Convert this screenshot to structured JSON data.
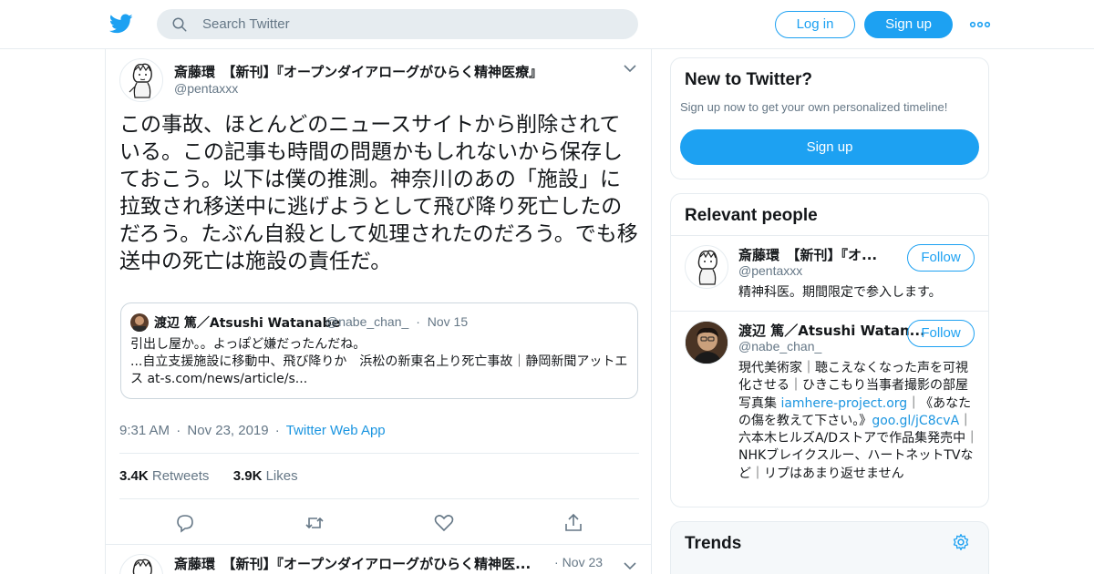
{
  "header": {
    "logo": "twitter-bird-icon",
    "search_placeholder": "Search Twitter",
    "login_label": "Log in",
    "signup_label": "Sign up",
    "more_icon": "more-dots-icon"
  },
  "tweet": {
    "author_name": "斎藤環　【新刊】『オープンダイアローグがひらく精神医療』",
    "author_handle": "@pentaxxx",
    "text": "この事故、ほとんどのニュースサイトから削除されている。この記事も時間の問題かもしれないから保存しておこう。以下は僕の推測。神奈川のあの「施設」に拉致され移送中に逃げようとして飛び降り死亡したのだろう。たぶん自殺として処理されたのだろう。でも移送中の死亡は施設の責任だ。",
    "quote": {
      "name": "渡辺 篤／Atsushi Watanabe",
      "handle": "@nabe_chan_",
      "date": "Nov 15",
      "line1": "引出し屋か。。よっぽど嫌だったんだね。",
      "line2": "...自立支援施設に移動中、飛び降りか　浜松の新東名上り死亡事故｜静岡新聞アットエス at-s.com/news/article/s..."
    },
    "time": "9:31 AM",
    "date": "Nov 23, 2019",
    "source": "Twitter Web App",
    "retweets_count": "3.4K",
    "retweets_label": "Retweets",
    "likes_count": "3.9K",
    "likes_label": "Likes",
    "actions": [
      "reply-icon",
      "retweet-icon",
      "like-icon",
      "share-icon"
    ]
  },
  "next_tweet": {
    "author_name": "斎藤環　【新刊】『オープンダイアローグがひらく精神医...",
    "date": "Nov 23"
  },
  "sidebar": {
    "new_title": "New to Twitter?",
    "new_sub": "Sign up now to get your own personalized timeline!",
    "new_signup": "Sign up",
    "relevant_title": "Relevant people",
    "people": [
      {
        "name": "斎藤環　【新刊】『オ...",
        "handle": "@pentaxxx",
        "follow": "Follow",
        "bio": "精神科医。期間限定で参入します。"
      },
      {
        "name": "渡辺 篤／Atsushi Watan...",
        "handle": "@nabe_chan_",
        "follow": "Follow",
        "bio_a": "現代美術家｜聴こえなくなった声を可視化させる｜ひきこもり当事者撮影の部屋写真集 ",
        "bio_link1": "iamhere-project.org",
        "bio_b": "｜《あなたの傷を教えて下さい。》",
        "bio_link2": "goo.gl/jC8cvA",
        "bio_c": "｜六本木ヒルズA/Dストアで作品集発売中｜NHKブレイクスルー、ハートネットTVなど｜リプはあまり返せません"
      }
    ],
    "trends_title": "Trends"
  },
  "colors": {
    "accent": "#1da1f2",
    "link": "#1b95e0",
    "muted": "#657786",
    "border": "#e6ecf0"
  }
}
